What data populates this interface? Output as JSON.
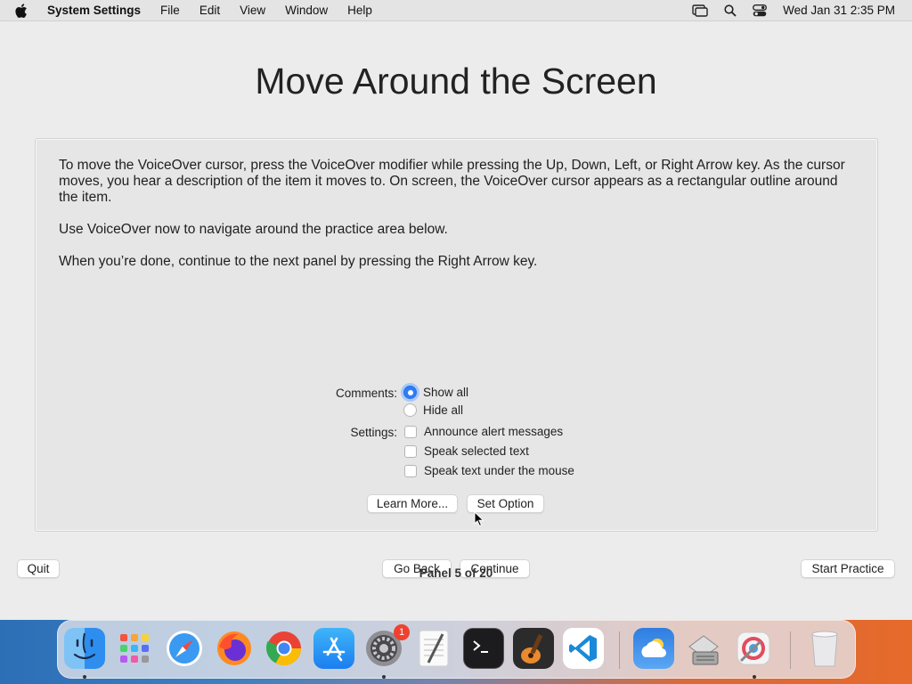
{
  "menubar": {
    "app_name": "System Settings",
    "menus": [
      "File",
      "Edit",
      "View",
      "Window",
      "Help"
    ],
    "clock": "Wed Jan 31  2:35 PM"
  },
  "page": {
    "title": "Move Around the Screen",
    "paragraph1": "To move the VoiceOver cursor, press the VoiceOver modifier while pressing the Up, Down, Left, or Right Arrow key. As the cursor moves, you hear a description of the item it moves to. On screen, the VoiceOver cursor appears as a rectangular outline around the item.",
    "paragraph2": "Use VoiceOver now to navigate around the practice area below.",
    "paragraph3": "When you’re done, continue to the next panel by pressing the Right Arrow key."
  },
  "practice": {
    "comments_label": "Comments:",
    "comments_options": [
      {
        "label": "Show all",
        "selected": true
      },
      {
        "label": "Hide all",
        "selected": false
      }
    ],
    "settings_label": "Settings:",
    "settings_options": [
      {
        "label": "Announce alert messages",
        "checked": false
      },
      {
        "label": "Speak selected text",
        "checked": false
      },
      {
        "label": "Speak text under the mouse",
        "checked": false
      }
    ],
    "learn_more_label": "Learn More...",
    "set_option_label": "Set Option"
  },
  "footer": {
    "quit_label": "Quit",
    "go_back_label": "Go Back",
    "continue_label": "Continue",
    "start_practice_label": "Start Practice",
    "panel_count": "Panel 5 of 20"
  },
  "dock": {
    "apps": [
      "finder-icon",
      "launchpad-icon",
      "safari-icon",
      "firefox-icon",
      "chrome-icon",
      "app-store-icon",
      "system-settings-icon",
      "textedit-icon",
      "terminal-icon",
      "garageband-icon",
      "vscode-icon",
      "weather-icon",
      "archive-utility-icon",
      "colorsync-icon",
      "trash-icon"
    ],
    "settings_badge": "1"
  }
}
